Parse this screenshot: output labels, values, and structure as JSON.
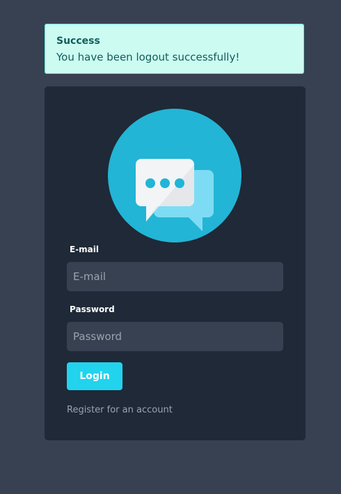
{
  "alert": {
    "title": "Success",
    "message": "You have been logout successfully!"
  },
  "form": {
    "email_label": "E-mail",
    "email_placeholder": "E-mail",
    "email_value": "",
    "password_label": "Password",
    "password_placeholder": "Password",
    "password_value": "",
    "login_label": "Login",
    "register_link": "Register for an account"
  },
  "logo": {
    "icon": "chat-bubbles-icon"
  },
  "colors": {
    "page_background": "#384152",
    "card_background": "#1f2937",
    "input_background": "#374151",
    "accent": "#22d3ee",
    "alert_background": "#ccfbf1",
    "alert_text": "#115e59"
  }
}
